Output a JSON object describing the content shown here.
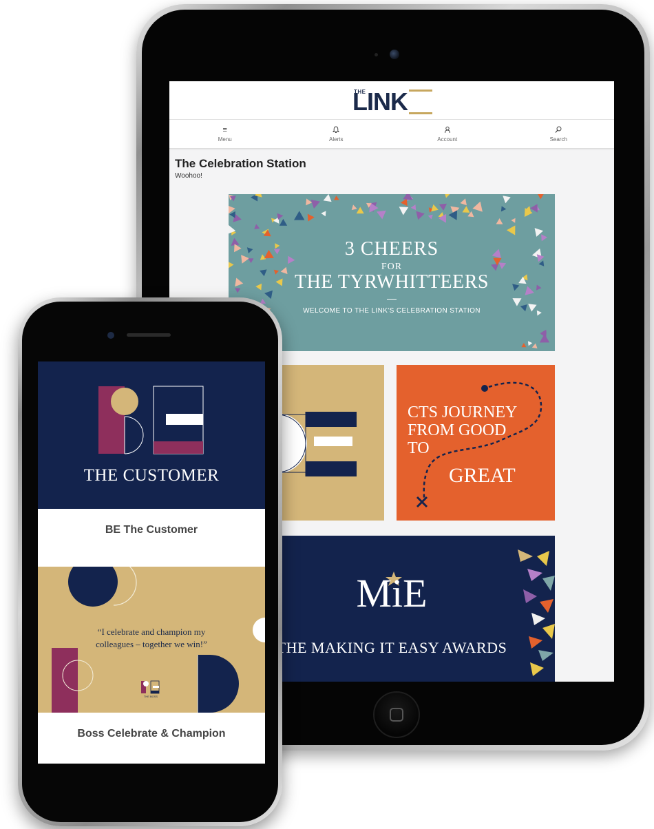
{
  "app": {
    "logo_prefix": "THE",
    "logo_word": "LINK",
    "nav": [
      {
        "label": "Menu",
        "icon": "menu-icon"
      },
      {
        "label": "Alerts",
        "icon": "bell-icon"
      },
      {
        "label": "Account",
        "icon": "user-icon"
      },
      {
        "label": "Search",
        "icon": "search-icon"
      }
    ],
    "page_title": "The Celebration Station",
    "page_subtitle": "Woohoo!"
  },
  "tiles": {
    "cheers": {
      "line1": "3 CHEERS",
      "line2": "FOR",
      "line3": "THE TYRWHITTEERS",
      "line4": "WELCOME TO THE LINK'S CELEBRATION STATION"
    },
    "cts": {
      "line1": "CTS JOURNEY",
      "line2": "FROM GOOD",
      "line3": "TO",
      "line4": "GREAT"
    },
    "mie": {
      "logo": "MiE",
      "subtitle": "THE MAKING IT EASY AWARDS"
    }
  },
  "phone": {
    "card1_text": "THE CUSTOMER",
    "card1_label": "BE The Customer",
    "card2_quote_l1": "“I celebrate and champion my",
    "card2_quote_l2": "colleagues – together we win!”",
    "card2_caption": "THE BOSS",
    "card2_label": "Boss Celebrate & Champion"
  },
  "colors": {
    "navy": "#13234d",
    "gold": "#d4b679",
    "teal": "#6e9ea0",
    "orange": "#e4612d",
    "plum": "#8e2f5c"
  }
}
